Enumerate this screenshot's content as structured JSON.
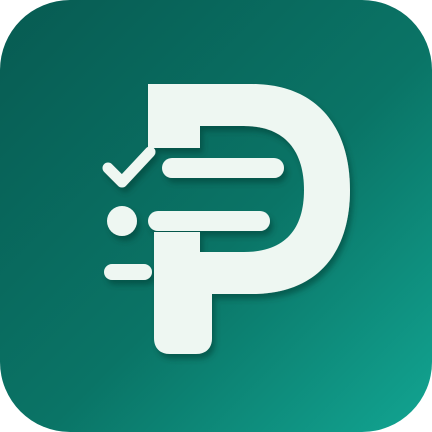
{
  "icon": {
    "name": "checklist-p-app-icon",
    "colors": {
      "background_start": "#075b52",
      "background_mid": "#0a7466",
      "background_end": "#12a592",
      "glyph": "#eef7f2",
      "glyph_shadow": "#043e38"
    }
  }
}
